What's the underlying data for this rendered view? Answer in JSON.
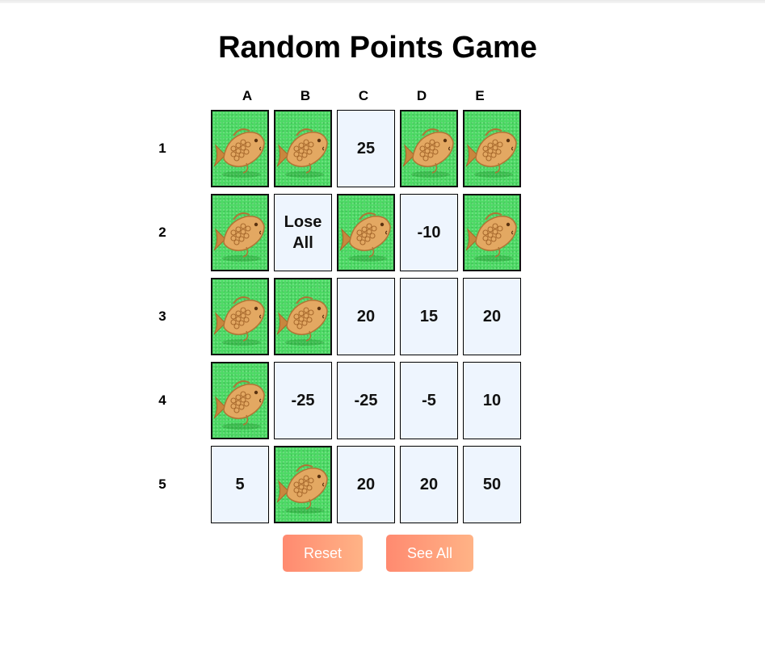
{
  "title": "Random Points Game",
  "columns": [
    "A",
    "B",
    "C",
    "D",
    "E"
  ],
  "rows": [
    "1",
    "2",
    "3",
    "4",
    "5"
  ],
  "colors": {
    "covered_tile": "#4cd964",
    "revealed_tile": "#eef5fe",
    "button_gradient_start": "#ff8a70",
    "button_gradient_end": "#ffb386"
  },
  "covered_icon": "taiyaki-fish-icon",
  "grid": [
    [
      {
        "state": "covered"
      },
      {
        "state": "covered"
      },
      {
        "state": "revealed",
        "value": "25"
      },
      {
        "state": "covered"
      },
      {
        "state": "covered"
      }
    ],
    [
      {
        "state": "covered"
      },
      {
        "state": "revealed",
        "value": "Lose All"
      },
      {
        "state": "covered"
      },
      {
        "state": "revealed",
        "value": "-10"
      },
      {
        "state": "covered"
      }
    ],
    [
      {
        "state": "covered"
      },
      {
        "state": "covered"
      },
      {
        "state": "revealed",
        "value": "20"
      },
      {
        "state": "revealed",
        "value": "15"
      },
      {
        "state": "revealed",
        "value": "20"
      }
    ],
    [
      {
        "state": "covered"
      },
      {
        "state": "revealed",
        "value": "-25"
      },
      {
        "state": "revealed",
        "value": "-25"
      },
      {
        "state": "revealed",
        "value": "-5"
      },
      {
        "state": "revealed",
        "value": "10"
      }
    ],
    [
      {
        "state": "revealed",
        "value": "5"
      },
      {
        "state": "covered"
      },
      {
        "state": "revealed",
        "value": "20"
      },
      {
        "state": "revealed",
        "value": "20"
      },
      {
        "state": "revealed",
        "value": "50"
      }
    ]
  ],
  "buttons": {
    "reset_label": "Reset",
    "see_all_label": "See All"
  }
}
